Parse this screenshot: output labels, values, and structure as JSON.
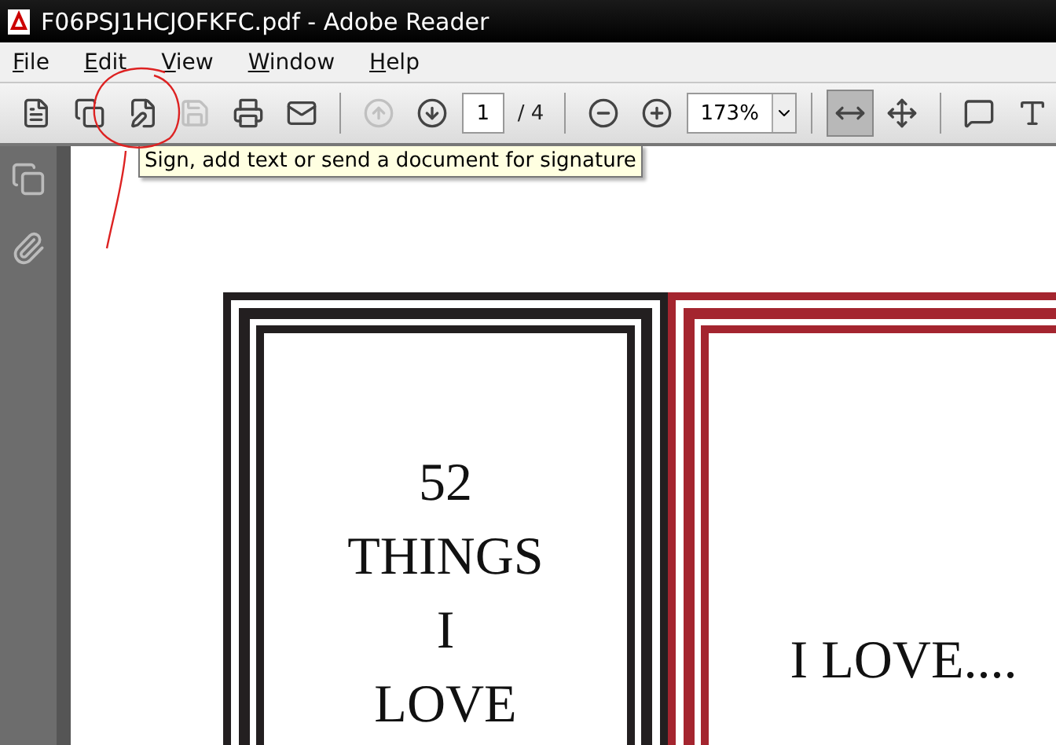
{
  "window": {
    "title": "F06PSJ1HCJOFKFC.pdf - Adobe Reader"
  },
  "menu": [
    {
      "label": "File"
    },
    {
      "label": "Edit"
    },
    {
      "label": "View"
    },
    {
      "label": "Window"
    },
    {
      "label": "Help"
    }
  ],
  "toolbar": [
    {
      "kind": "create",
      "disabled": false
    },
    {
      "kind": "export",
      "disabled": false
    },
    {
      "kind": "sign",
      "disabled": false
    },
    {
      "kind": "save",
      "disabled": true
    },
    {
      "kind": "print",
      "disabled": false
    },
    {
      "kind": "email",
      "disabled": false
    },
    {
      "kind": "separator"
    },
    {
      "kind": "prev",
      "disabled": true
    },
    {
      "kind": "next",
      "disabled": false
    },
    {
      "kind": "page",
      "value": "1",
      "total": "/ 4"
    },
    {
      "kind": "separator"
    },
    {
      "kind": "zoom-out",
      "disabled": false
    },
    {
      "kind": "zoom-in",
      "disabled": false
    },
    {
      "kind": "zoom",
      "value": "173%"
    },
    {
      "kind": "separator"
    },
    {
      "kind": "fit-width",
      "selected": true
    },
    {
      "kind": "fit-page",
      "selected": false
    },
    {
      "kind": "separator"
    },
    {
      "kind": "comment",
      "disabled": false
    },
    {
      "kind": "annotate",
      "disabled": false
    }
  ],
  "tooltip": "Sign, add text or send a document for signature",
  "sidebar": [
    {
      "kind": "pages"
    },
    {
      "kind": "attachments"
    }
  ],
  "document": {
    "left_page": [
      "52",
      "THINGS",
      "I",
      "LOVE"
    ],
    "right_page": "I LOVE...."
  }
}
